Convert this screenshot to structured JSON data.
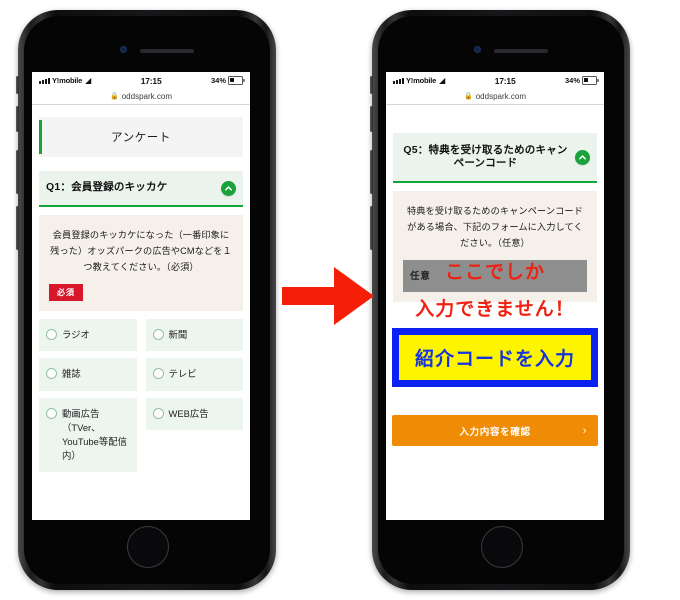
{
  "statusbar": {
    "carrier": "Y!mobile",
    "wifi_icon": "wifi-icon",
    "time": "17:15",
    "battery_pct": "34%"
  },
  "urlbar": {
    "lock_icon": "lock-icon",
    "url": "oddspark.com"
  },
  "left_phone": {
    "survey_title": "アンケート",
    "question": {
      "heading": "Q1：会員登録のキッカケ",
      "collapse_icon": "chevron-up-icon",
      "description": "会員登録のキッカケになった（一番印象に残った）オッズパークの広告やCMなどを１つ教えてください。（必須）",
      "badge": "必須"
    },
    "options": [
      {
        "label": "ラジオ"
      },
      {
        "label": "新聞"
      },
      {
        "label": "雑誌"
      },
      {
        "label": "テレビ"
      },
      {
        "label": "動画広告（TVer、YouTube等配信内）"
      },
      {
        "label": "WEB広告"
      }
    ]
  },
  "right_phone": {
    "question": {
      "heading": "Q5：特典を受け取るためのキャンペーンコード",
      "collapse_icon": "chevron-up-icon",
      "description": "特典を受け取るためのキャンペーンコードがある場合、下記のフォームに入力してください。（任意）",
      "badge": "任意"
    },
    "code_field_label": "紹介コードを入力",
    "confirm_button": "入力内容を確認",
    "confirm_chevron_icon": "chevron-right-icon"
  },
  "annotation": {
    "line1": "ここでしか",
    "line2": "入力できません！",
    "arrow_icon": "right-arrow-icon"
  },
  "colors": {
    "green": "#13a538",
    "red_badge": "#d7182a",
    "gray_badge": "#8e8e8e",
    "orange": "#ef8b05",
    "blue": "#0a21f0",
    "yellow": "#fdf500",
    "annotation_red": "#ef2112"
  }
}
